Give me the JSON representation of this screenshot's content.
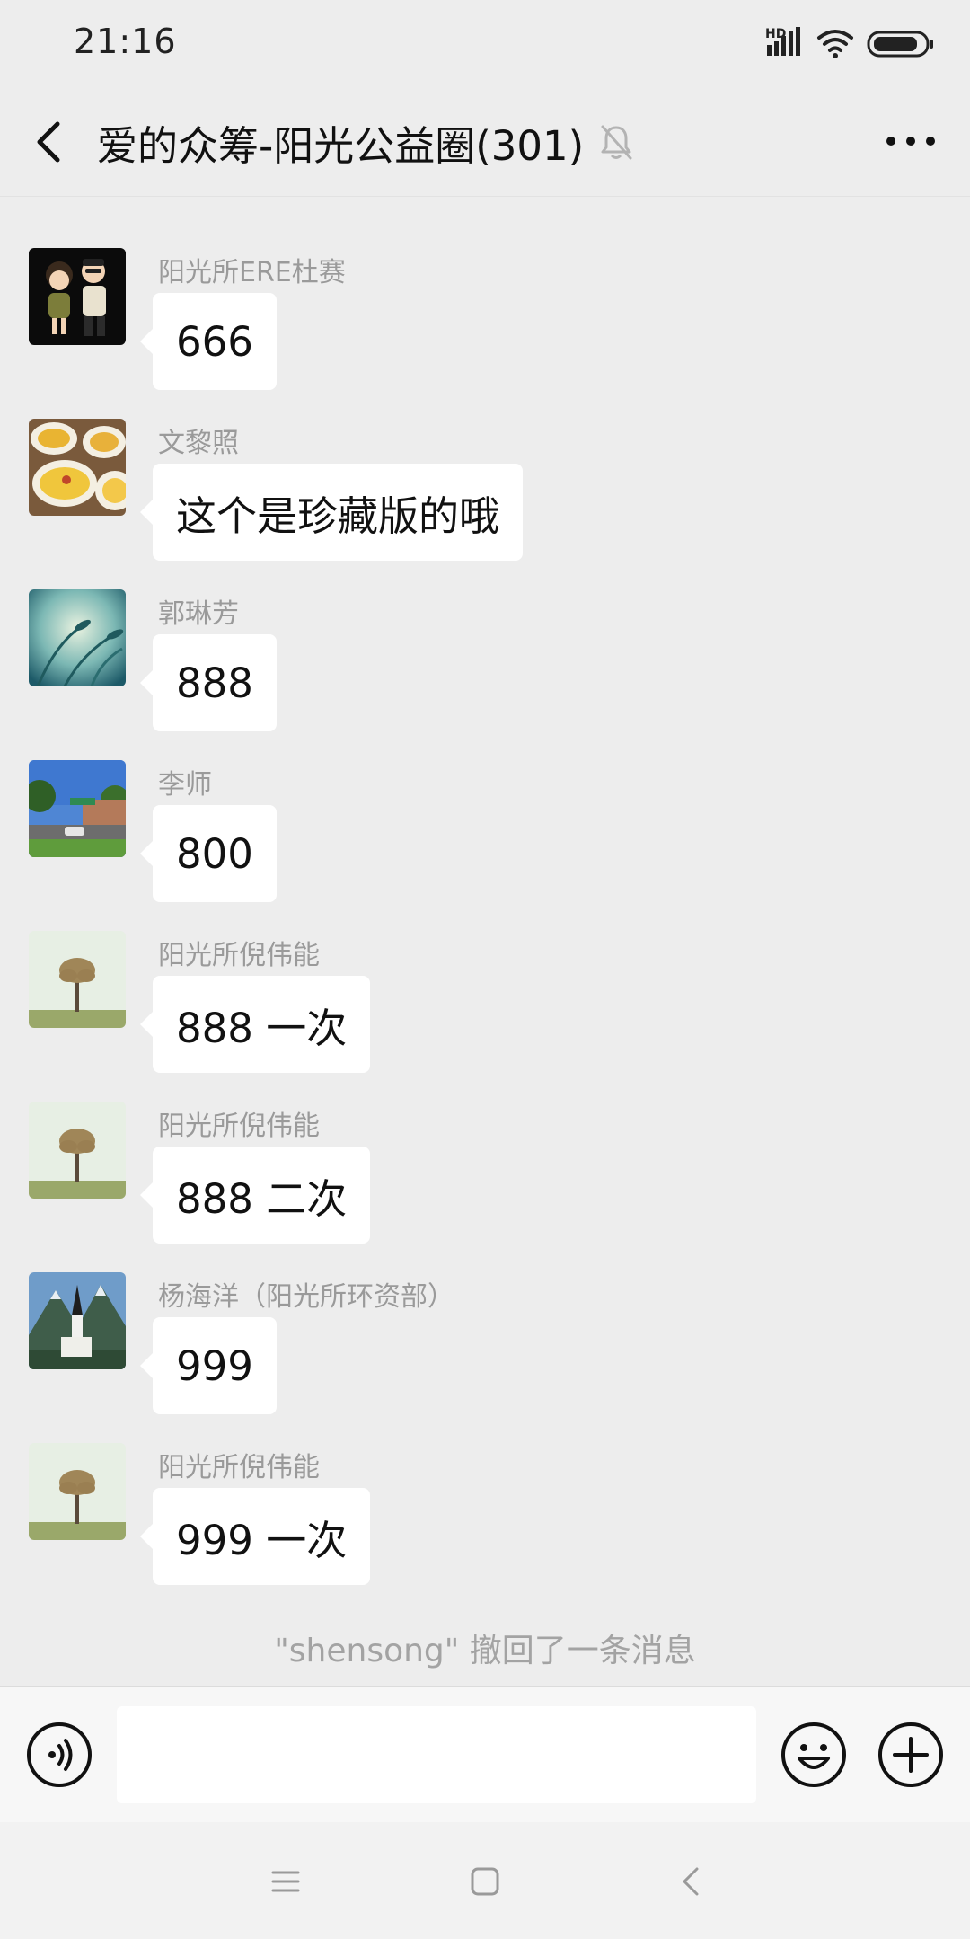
{
  "status_bar": {
    "time": "21:16",
    "network_label": "HD",
    "icons": [
      "signal-icon",
      "wifi-icon",
      "battery-icon"
    ]
  },
  "nav": {
    "title": "爱的众筹-阳光公益圈(301)",
    "back_icon": "chevron-left-icon",
    "mute_icon": "bell-off-icon",
    "more_icon": "more-horizontal-icon"
  },
  "messages": [
    {
      "sender": "阳光所ERE杜赛",
      "text": "666",
      "avatar": "avatar-illustration-couple"
    },
    {
      "sender": "文黎照",
      "text": "这个是珍藏版的哦",
      "avatar": "avatar-food-plates"
    },
    {
      "sender": "郭琳芳",
      "text": "888",
      "avatar": "avatar-wheat-field"
    },
    {
      "sender": "李师",
      "text": "800",
      "avatar": "avatar-street-view"
    },
    {
      "sender": "阳光所倪伟能",
      "text": "888 一次",
      "avatar": "avatar-lone-tree"
    },
    {
      "sender": "阳光所倪伟能",
      "text": "888 二次",
      "avatar": "avatar-lone-tree"
    },
    {
      "sender": "杨海洋（阳光所环资部）",
      "text": "999",
      "avatar": "avatar-church-mountains"
    },
    {
      "sender": "阳光所倪伟能",
      "text": "999 一次",
      "avatar": "avatar-lone-tree"
    }
  ],
  "system_message": "\"shensong\" 撤回了一条消息",
  "input_bar": {
    "input_value": "",
    "voice_icon": "voice-icon",
    "emoji_icon": "emoji-icon",
    "plus_icon": "plus-circle-icon"
  },
  "system_nav": {
    "icons": [
      "menu-icon",
      "home-square-icon",
      "back-triangle-icon"
    ]
  },
  "colors": {
    "background": "#ededed",
    "bubble": "#ffffff",
    "sender_name": "#9a9a9a",
    "system_text": "#a3a3a3"
  }
}
